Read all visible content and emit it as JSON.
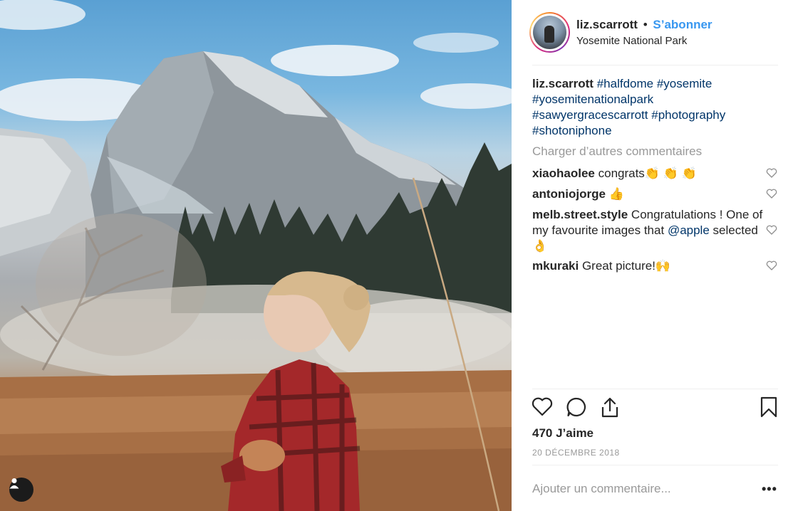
{
  "post": {
    "username": "liz.scarrott",
    "separator": "•",
    "follow_label": "S’abonner",
    "location": "Yosemite National Park",
    "caption": {
      "username": "liz.scarrott",
      "hashtags": [
        "#halfdome",
        "#yosemite",
        "#yosemitenationalpark",
        "#sawyergracescarrott",
        "#photography",
        "#shotoniphone"
      ]
    },
    "load_more_label": "Charger d’autres commentaires",
    "comments": [
      {
        "username": "xiaohaolee",
        "text": "congrats👏 👏 👏"
      },
      {
        "username": "antoniojorge",
        "text": "👍"
      },
      {
        "username": "melb.street.style",
        "text_before": "Congratulations ! One of my favourite images that",
        "mention": "@apple",
        "text_after": "selected 👌"
      },
      {
        "username": "mkuraki",
        "text": "Great picture!🙌"
      }
    ],
    "likes_label": "470 J’aime",
    "date_label": "20 DÉCEMBRE 2018",
    "add_comment_placeholder": "Ajouter un commentaire...",
    "more_options": "•••"
  },
  "icons": {
    "like": "heart-icon",
    "comment": "comment-bubble-icon",
    "share": "share-icon",
    "save": "bookmark-icon",
    "comment_like": "heart-icon",
    "tagged_user": "user-tag-icon"
  },
  "colors": {
    "link": "#3897f0",
    "hashtag": "#003569",
    "muted": "#999999",
    "text": "#262626"
  }
}
